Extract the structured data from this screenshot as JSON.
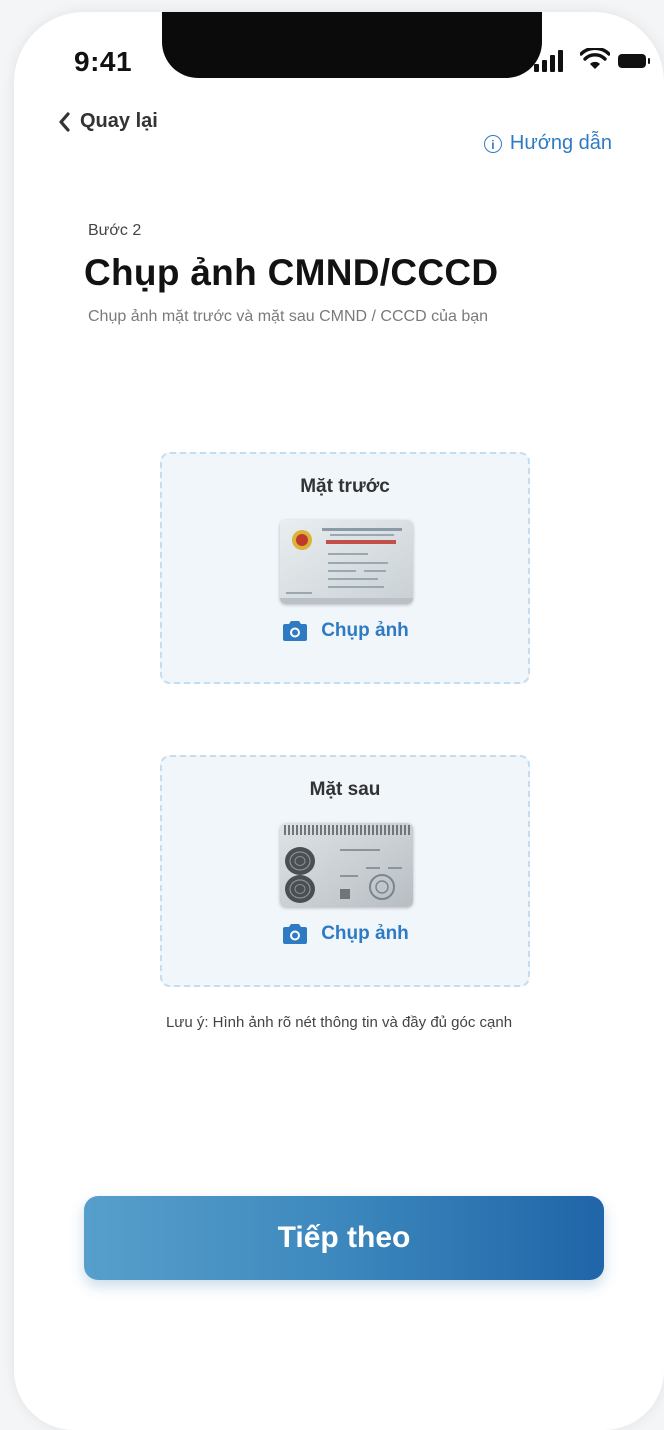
{
  "status": {
    "time": "9:41"
  },
  "nav": {
    "back_label": "Quay lại",
    "guide_label": "Hướng dẫn"
  },
  "header": {
    "step": "Bước 2",
    "title": "Chụp ảnh CMND/CCCD",
    "subtitle": "Chụp ảnh mặt trước và mặt sau CMND / CCCD của bạn"
  },
  "cards": {
    "front": {
      "title": "Mặt trước",
      "action": "Chụp ảnh"
    },
    "back": {
      "title": "Mặt sau",
      "action": "Chụp ảnh"
    }
  },
  "note": "Lưu ý: Hình ảnh rõ nét thông tin và đầy đủ góc cạnh",
  "next_button": "Tiếp theo",
  "colors": {
    "accent": "#2f7bc3",
    "card_bg": "#f1f6fb",
    "card_border": "#c6dcef"
  },
  "icons": {
    "back": "chevron-left-icon",
    "guide": "info-icon",
    "capture": "camera-icon"
  }
}
